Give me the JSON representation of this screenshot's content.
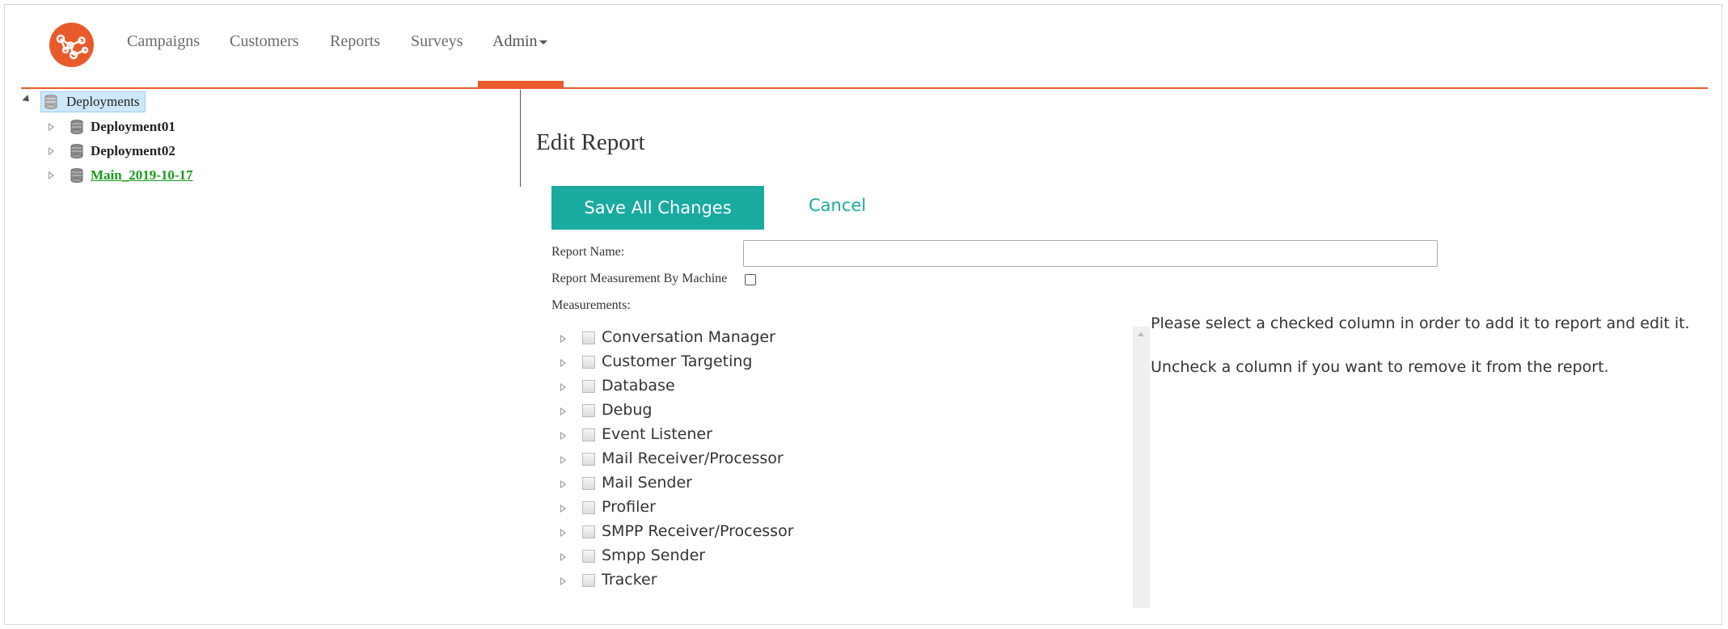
{
  "brand": {
    "accent": "#e95a2b",
    "teal": "#19aaa0"
  },
  "nav": {
    "items": [
      "Campaigns",
      "Customers",
      "Reports",
      "Surveys"
    ],
    "admin_label": "Admin"
  },
  "tree": {
    "root": "Deployments",
    "children": [
      {
        "label": "Deployment01",
        "color": "#222"
      },
      {
        "label": "Deployment02",
        "color": "#222"
      },
      {
        "label": "Main_2019-10-17",
        "color": "#1a9a1a"
      }
    ]
  },
  "main": {
    "title": "Edit Report",
    "save_label": "Save All Changes",
    "cancel_label": "Cancel",
    "report_name_label": "Report Name:",
    "report_name_value": "",
    "by_machine_label": "Report Measurement By Machine",
    "by_machine_checked": false,
    "measurements_label": "Measurements:",
    "measurements": [
      "Conversation Manager",
      "Customer Targeting",
      "Database",
      "Debug",
      "Event Listener",
      "Mail Receiver/Processor",
      "Mail Sender",
      "Profiler",
      "SMPP Receiver/Processor",
      "Smpp Sender",
      "Tracker"
    ],
    "help_line_1": "Please select a checked column in order to add it to report and edit it.",
    "help_line_2": "Uncheck a column if you want to remove it from the report."
  }
}
